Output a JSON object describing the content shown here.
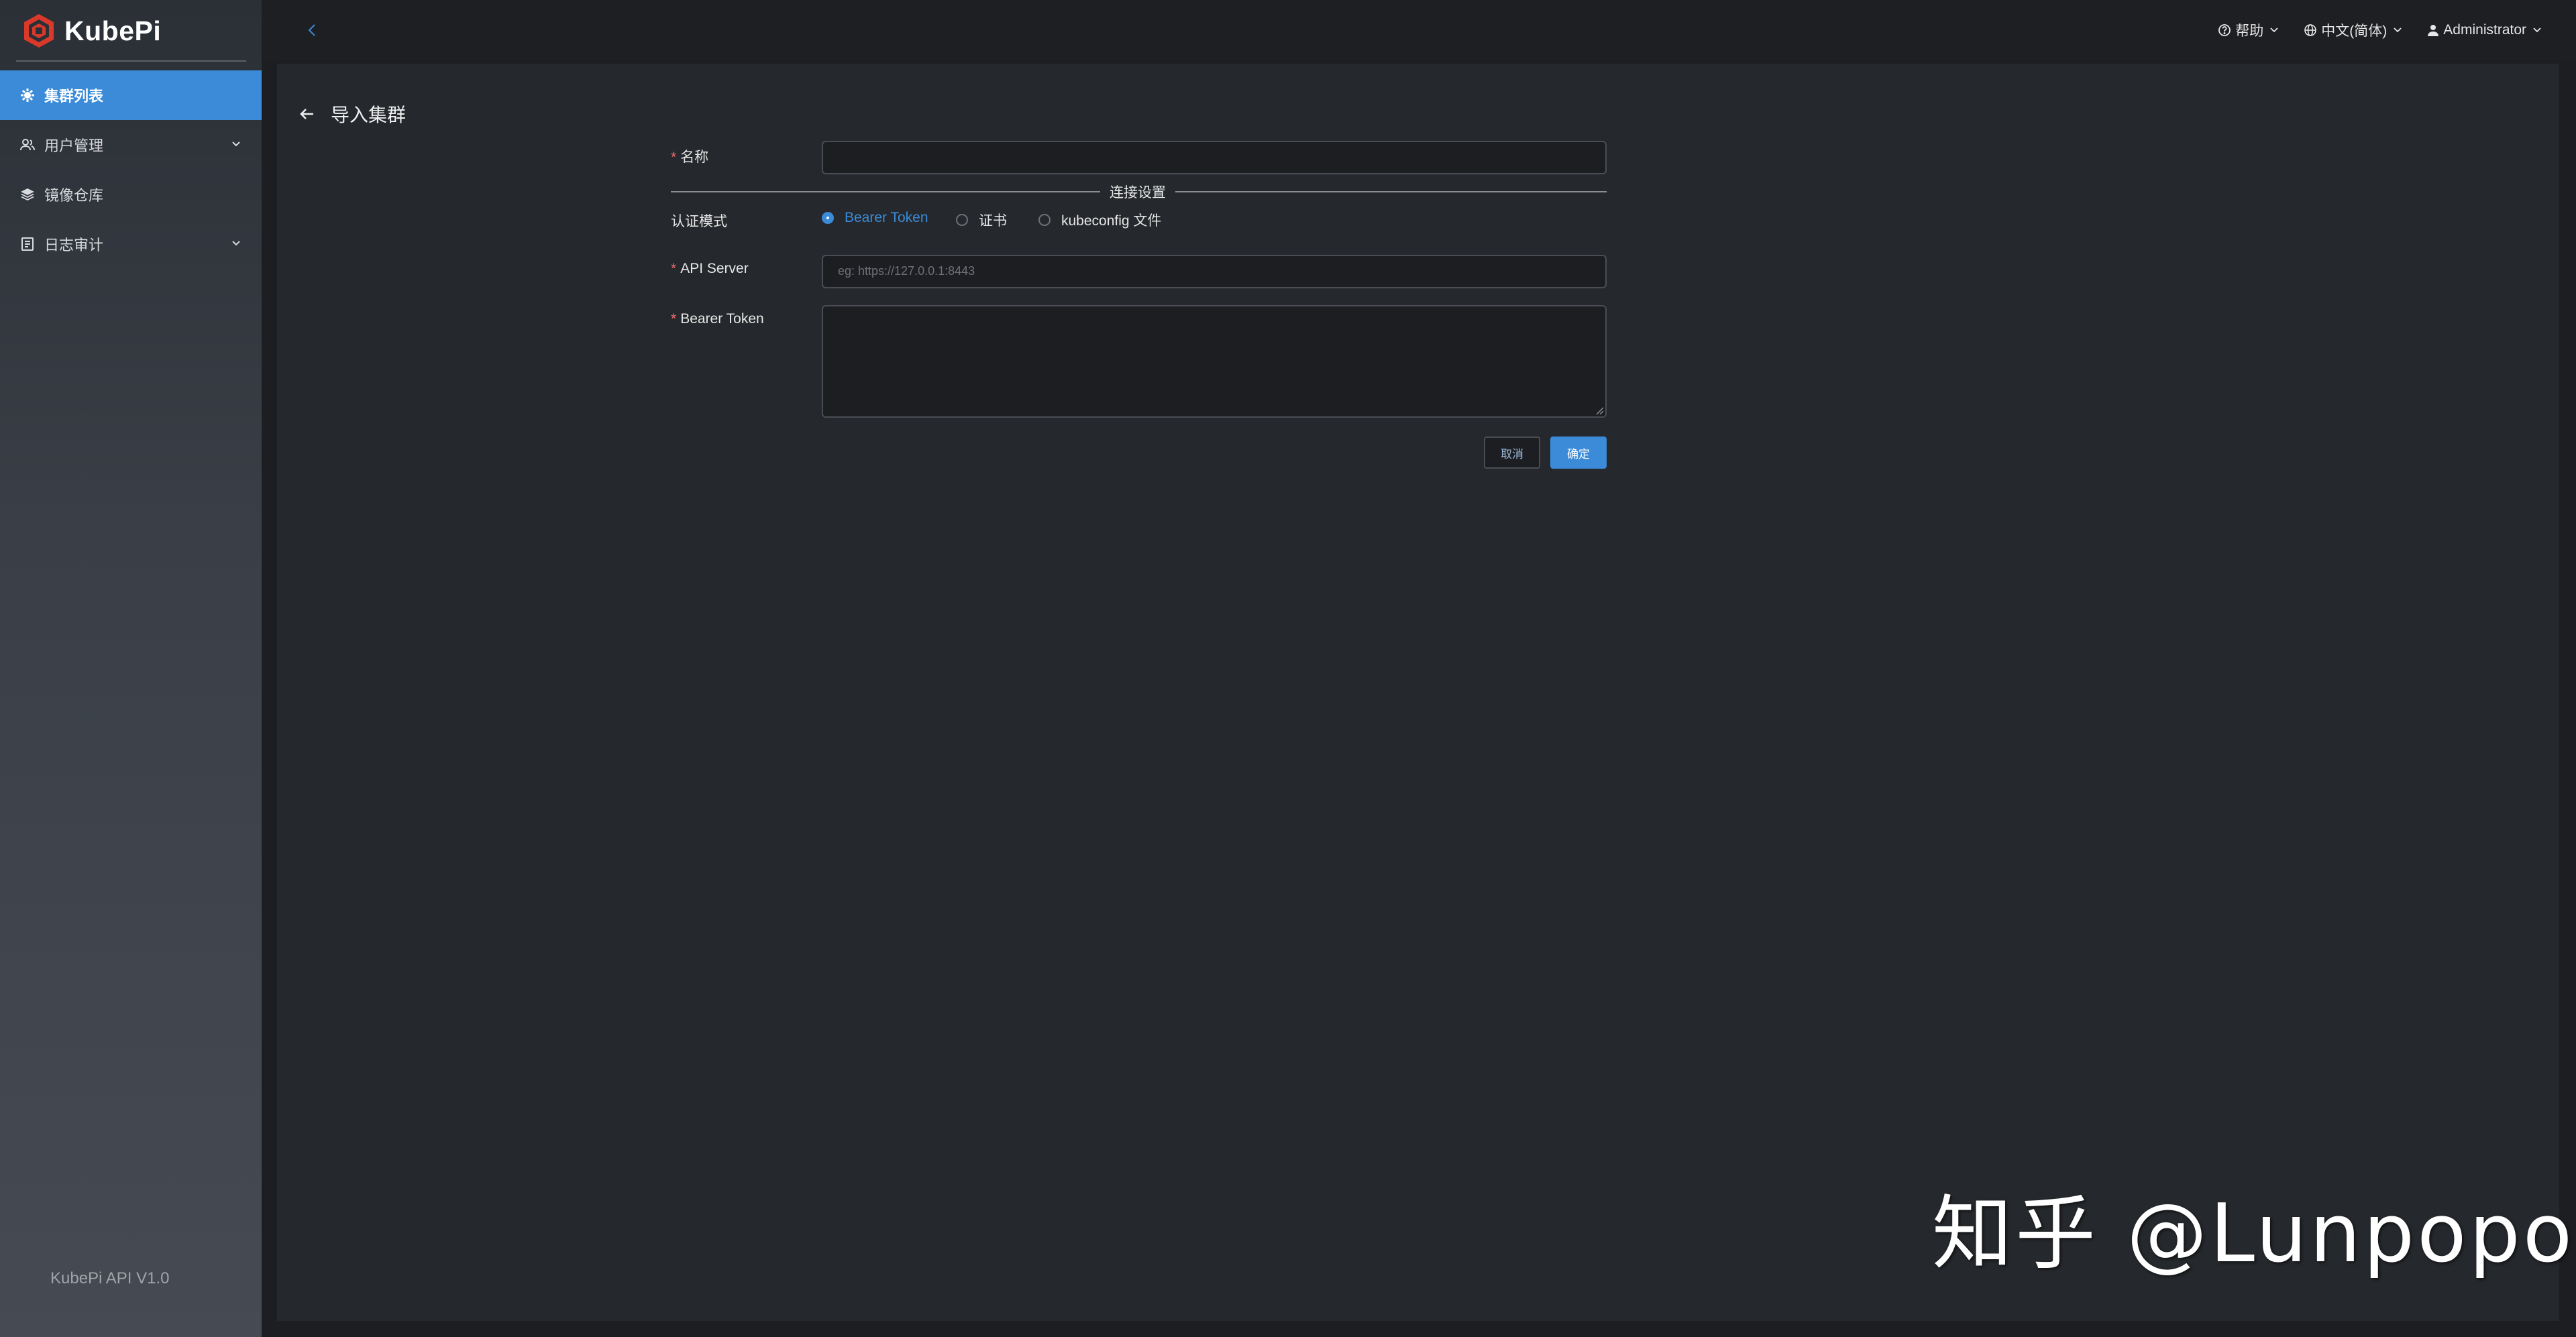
{
  "app": {
    "logo_text": "KubePi",
    "version": "KubePi API V1.0"
  },
  "sidebar": {
    "items": [
      {
        "label": "集群列表",
        "active": true
      },
      {
        "label": "用户管理",
        "has_children": true
      },
      {
        "label": "镜像仓库"
      },
      {
        "label": "日志审计",
        "has_children": true
      }
    ]
  },
  "header": {
    "help": "帮助",
    "language": "中文(简体)",
    "user": "Administrator"
  },
  "page": {
    "title": "导入集群"
  },
  "form": {
    "required_mark": "*",
    "name_label": "名称",
    "name_value": "",
    "section_title": "连接设置",
    "auth_mode_label": "认证模式",
    "auth_options": [
      "Bearer Token",
      "证书",
      "kubeconfig 文件"
    ],
    "auth_selected": "Bearer Token",
    "api_server_label": "API Server",
    "api_server_placeholder": "eg: https://127.0.0.1:8443",
    "token_label": "Bearer Token",
    "token_value": "",
    "cancel_label": "取消",
    "ok_label": "确定"
  },
  "watermark": "知乎 @Lunpopo",
  "colors": {
    "accent": "#3b8bd8",
    "required": "#f56c6c",
    "background": "#25282c"
  }
}
